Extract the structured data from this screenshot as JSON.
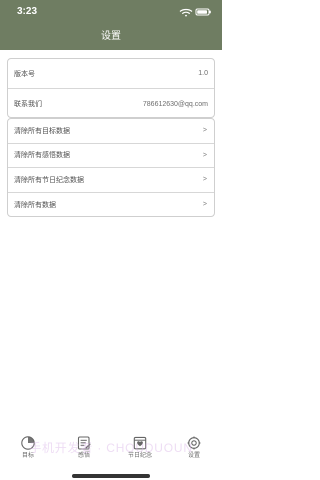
{
  "status_bar": {
    "time": "3:23",
    "icons": [
      "wifi-icon",
      "battery-icon"
    ]
  },
  "nav": {
    "title": "设置"
  },
  "info_rows": [
    {
      "label": "版本号",
      "value": "1.0"
    },
    {
      "label": "联系我们",
      "value": "786612630@qq.com"
    }
  ],
  "action_rows": [
    {
      "label": "清除所有目标数据",
      "chevron": ">"
    },
    {
      "label": "清除所有感悟数据",
      "chevron": ">"
    },
    {
      "label": "清除所有节日纪念数据",
      "chevron": ">"
    },
    {
      "label": "清除所有数据",
      "chevron": ">"
    }
  ],
  "tabs": [
    {
      "label": "目标",
      "icon": "target-icon"
    },
    {
      "label": "感悟",
      "icon": "note-icon"
    },
    {
      "label": "节日纪念",
      "icon": "calendar-icon"
    },
    {
      "label": "设置",
      "icon": "settings-icon"
    }
  ],
  "watermark": "手机开发者 · CHOUDUOUN",
  "colors": {
    "header_bg": "#6f7d62",
    "text_primary": "#4f4f4f",
    "text_secondary": "#6d6d6d",
    "border": "#cfcfcf"
  }
}
